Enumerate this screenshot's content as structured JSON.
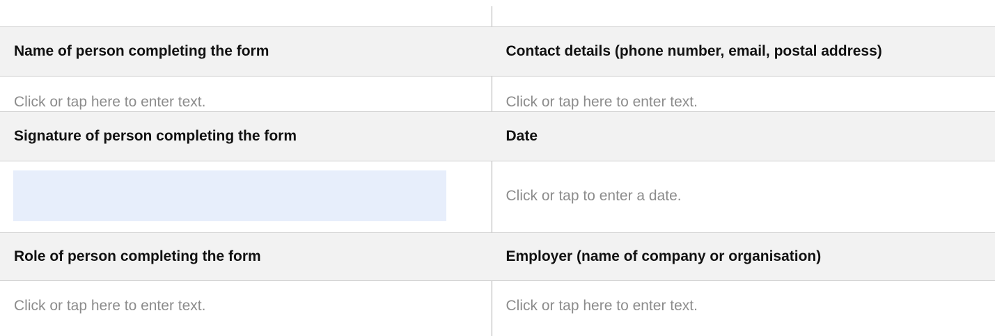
{
  "rows": [
    {
      "left_label": "Name of person completing the form",
      "right_label": "Contact details (phone number, email, postal address)"
    },
    {
      "left_value": "Click or tap here to enter text.",
      "right_value": "Click or tap here to enter text."
    },
    {
      "left_label": "Signature of person completing the form",
      "right_label": "Date"
    },
    {
      "left_value": "",
      "right_value": "Click or tap to enter a date."
    },
    {
      "left_label": "Role of person completing the form",
      "right_label": "Employer (name of company or organisation)"
    },
    {
      "left_value": "Click or tap here to enter text.",
      "right_value": "Click or tap here to enter text."
    }
  ],
  "colors": {
    "header_bg": "#f2f2f2",
    "placeholder_text": "#8c8c8c",
    "signature_box": "#e7eefb",
    "divider": "#a9a9a9"
  }
}
